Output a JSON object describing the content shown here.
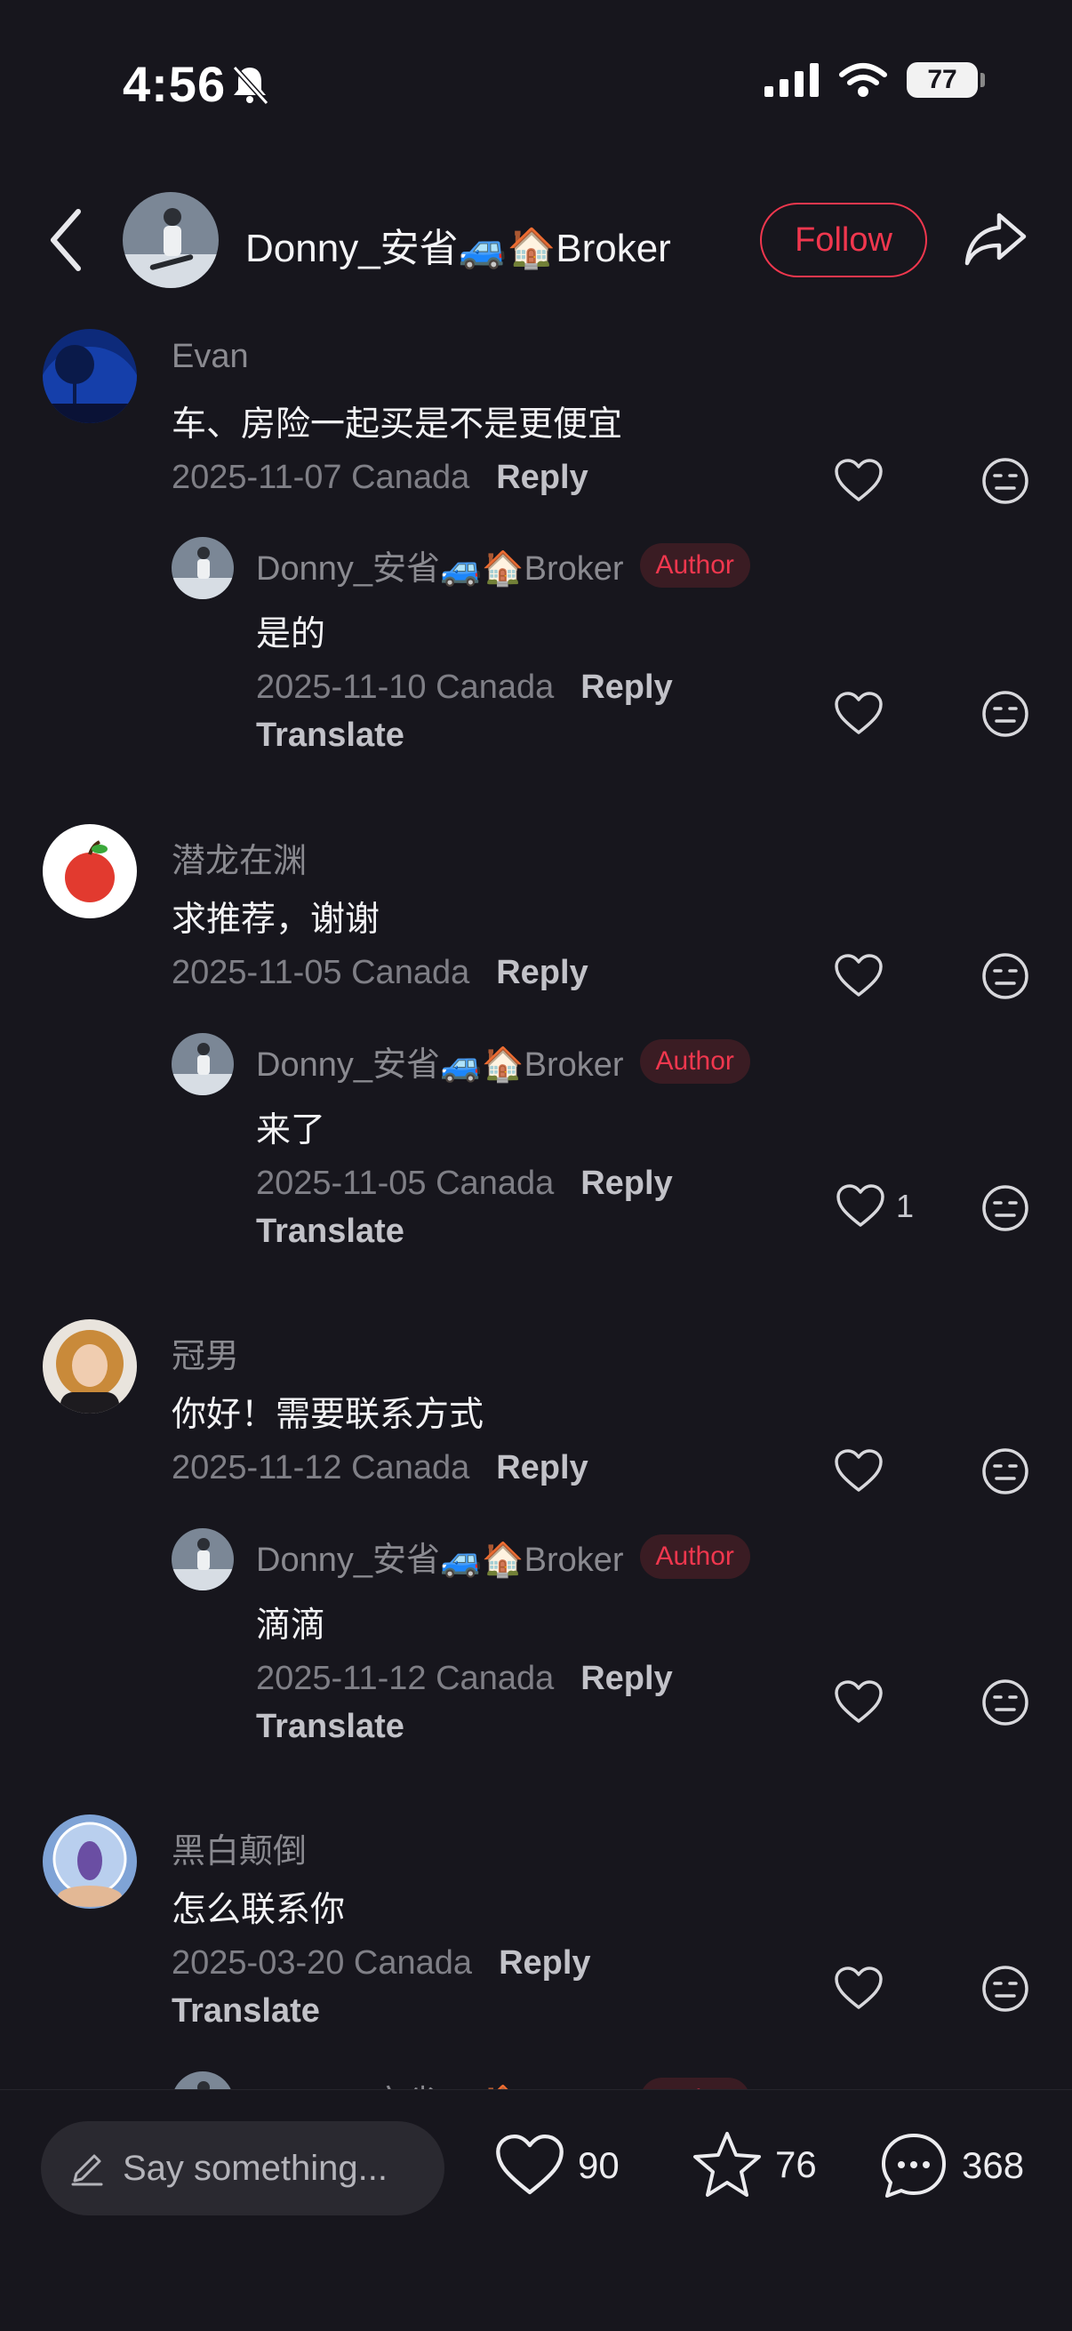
{
  "status": {
    "time": "4:56",
    "battery": "77"
  },
  "header": {
    "name": "Donny_安省🚙🏠Broker",
    "follow_label": "Follow"
  },
  "comments": [
    {
      "name": "Evan",
      "text": "车、房险一起买是不是更便宜",
      "meta": "2025-11-07 Canada",
      "reply_label": "Reply",
      "reply": {
        "name": "Donny_安省🚙🏠Broker",
        "badge": "Author",
        "text": "是的",
        "meta": "2025-11-10 Canada",
        "reply_label": "Reply",
        "translate_label": "Translate"
      }
    },
    {
      "name": "潜龙在渊",
      "text": "求推荐，谢谢",
      "meta": "2025-11-05 Canada",
      "reply_label": "Reply",
      "reply": {
        "name": "Donny_安省🚙🏠Broker",
        "badge": "Author",
        "text": "来了",
        "meta": "2025-11-05 Canada",
        "reply_label": "Reply",
        "translate_label": "Translate",
        "likes": "1"
      }
    },
    {
      "name": "冠男",
      "text": "你好！需要联系方式",
      "meta": "2025-11-12 Canada",
      "reply_label": "Reply",
      "reply": {
        "name": "Donny_安省🚙🏠Broker",
        "badge": "Author",
        "text": "滴滴",
        "meta": "2025-11-12 Canada",
        "reply_label": "Reply",
        "translate_label": "Translate"
      }
    },
    {
      "name": "黑白颠倒",
      "text": "怎么联系你",
      "meta": "2025-03-20 Canada",
      "reply_label": "Reply",
      "translate_label": "Translate",
      "reply": {
        "name": "Donny_安省🚙🏠Broker",
        "badge": "Author"
      }
    }
  ],
  "bottom": {
    "placeholder": "Say something...",
    "likes": "90",
    "stars": "76",
    "comments": "368"
  },
  "colors": {
    "accent": "#f0374e",
    "background": "#17161d"
  }
}
